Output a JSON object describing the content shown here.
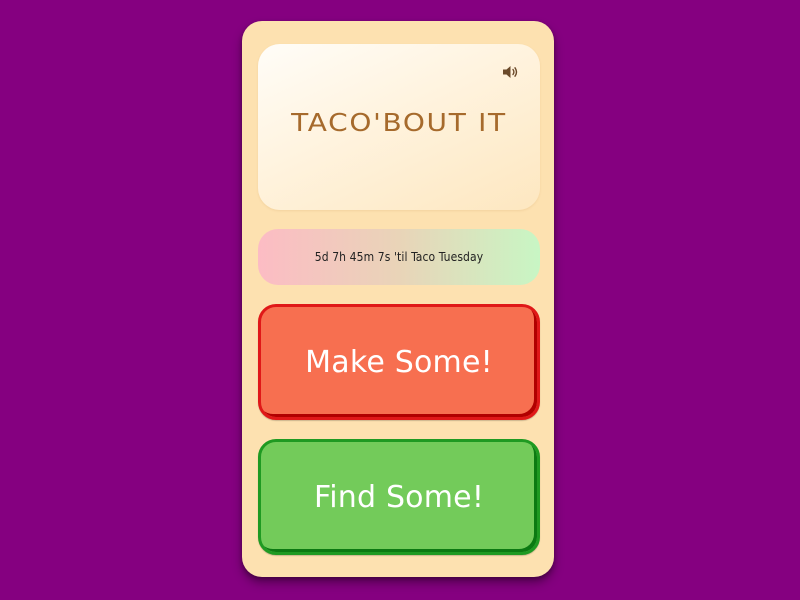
{
  "app": {
    "title": "TACO'BOUT IT",
    "sound_icon": "speaker-volume-icon"
  },
  "countdown": {
    "text": "5d 7h 45m 7s 'til Taco Tuesday"
  },
  "actions": {
    "make_label": "Make Some!",
    "find_label": "Find Some!"
  },
  "colors": {
    "background": "#850080",
    "card": "#fde1b0",
    "title": "#a66a2c",
    "make_button": "#f76f50",
    "make_border": "#e01818",
    "find_button": "#73cb5a",
    "find_border": "#1f9a22"
  }
}
